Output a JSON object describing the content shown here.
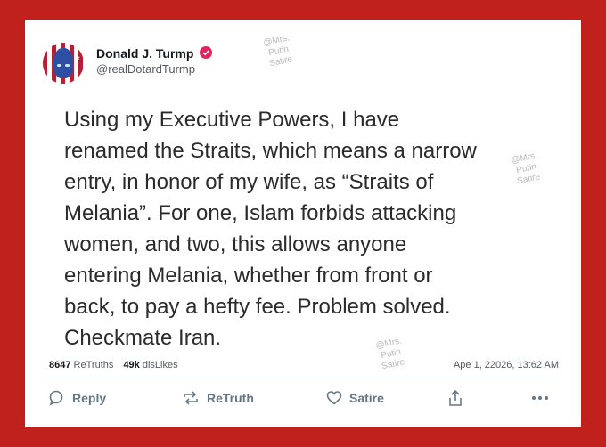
{
  "user": {
    "display_name": "Donald J. Turmp",
    "handle": "@realDotardTurmp"
  },
  "tweet": {
    "lines": [
      "Using my Executive Powers, I have",
      "renamed the Straits, which means a narrow",
      "entry, in honor of my wife, as “Straits of",
      "Melania”. For one, Islam forbids attacking",
      "women, and two, this allows anyone",
      "entering Melania, whether from front or",
      "back, to pay a hefty fee. Problem solved.",
      "Checkmate Iran."
    ]
  },
  "stats": {
    "retruths_count": "8647",
    "retruths_label": "ReTruths",
    "dislikes_count": "49k",
    "dislikes_label": "disLikes"
  },
  "timestamp": "Ape 1, 22026, 13:62 AM",
  "watermark": "@Mrs.\nPutin\nSatire",
  "actions": {
    "reply": "Reply",
    "retruth": "ReTruth",
    "satire": "Satire"
  },
  "icons": [
    "verified-badge-icon",
    "reply-icon",
    "retruth-icon",
    "heart-icon",
    "share-icon",
    "more-icon"
  ],
  "colors": {
    "frame": "#c0211d",
    "verified": "#e0245e",
    "action_gray": "#657786"
  }
}
